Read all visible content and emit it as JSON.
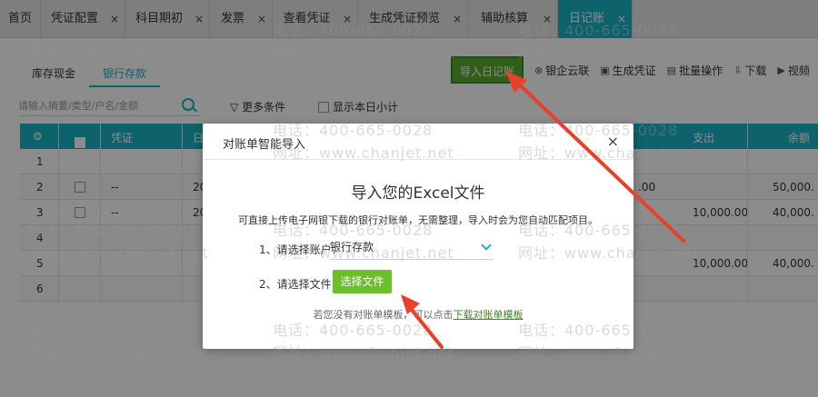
{
  "tabs": [
    {
      "label": "首页",
      "closable": false,
      "active": false
    },
    {
      "label": "凭证配置",
      "closable": true,
      "active": false
    },
    {
      "label": "科目期初",
      "closable": true,
      "active": false
    },
    {
      "label": "发票",
      "closable": true,
      "active": false
    },
    {
      "label": "查看凭证",
      "closable": true,
      "active": false
    },
    {
      "label": "生成凭证预览",
      "closable": true,
      "active": false
    },
    {
      "label": "辅助核算",
      "closable": true,
      "active": false
    },
    {
      "label": "日记账",
      "closable": true,
      "active": true
    }
  ],
  "close_glyph": "×",
  "subtabs": [
    {
      "label": "库存现金",
      "active": false
    },
    {
      "label": "银行存款",
      "active": true
    }
  ],
  "toolbar": {
    "import_label": "导入日记账",
    "items": [
      {
        "label": "银企云联",
        "icon": "link-icon"
      },
      {
        "label": "生成凭证",
        "icon": "voucher-icon"
      },
      {
        "label": "批量操作",
        "icon": "batch-icon"
      },
      {
        "label": "下载",
        "icon": "download-icon"
      },
      {
        "label": "视频",
        "icon": "play-icon"
      }
    ]
  },
  "search": {
    "placeholder": "请输入摘要/类型/户名/金额"
  },
  "filter": {
    "more_label": "更多条件",
    "show_subtotal_label": "显示本日小计"
  },
  "grid": {
    "headers": {
      "voucher": "凭证",
      "date": "日",
      "out": "支出",
      "balance": "余额"
    },
    "rows": [
      {
        "n": "1",
        "voucher": "",
        "date": "",
        "debit": "",
        "out": "",
        "balance": ""
      },
      {
        "n": "2",
        "voucher": "--",
        "date": "20",
        "debit": ".00",
        "out": "",
        "balance": "50,000."
      },
      {
        "n": "3",
        "voucher": "--",
        "date": "20",
        "debit": "",
        "out": "10,000.00",
        "balance": "40,000."
      },
      {
        "n": "4",
        "voucher": "",
        "date": "",
        "debit": "",
        "out": "",
        "balance": ""
      },
      {
        "n": "5",
        "voucher": "",
        "date": "",
        "debit": "",
        "out": "10,000.00",
        "balance": "40,000."
      },
      {
        "n": "6",
        "voucher": "",
        "date": "",
        "debit": "",
        "out": "",
        "balance": ""
      }
    ]
  },
  "dialog": {
    "title": "对账单智能导入",
    "close": "×",
    "heading": "导入您的Excel文件",
    "description": "可直接上传电子网银下载的银行对账单，无需整理，导入时会为您自动匹配项目。",
    "step1_label": "1、请选择账户：",
    "account_value": "银行存款",
    "step2_label": "2、请选择文件：",
    "file_button": "选择文件",
    "footer_prefix": "若您没有对账单模板，可以点击",
    "footer_link": "下载对账单模板"
  },
  "watermark": {
    "phone": "电话：400-665-0028",
    "site": "网址：www.chanjet.net"
  },
  "colors": {
    "accent": "#1ab2c4",
    "green": "#5aab2c",
    "arrow": "#e8402a"
  }
}
